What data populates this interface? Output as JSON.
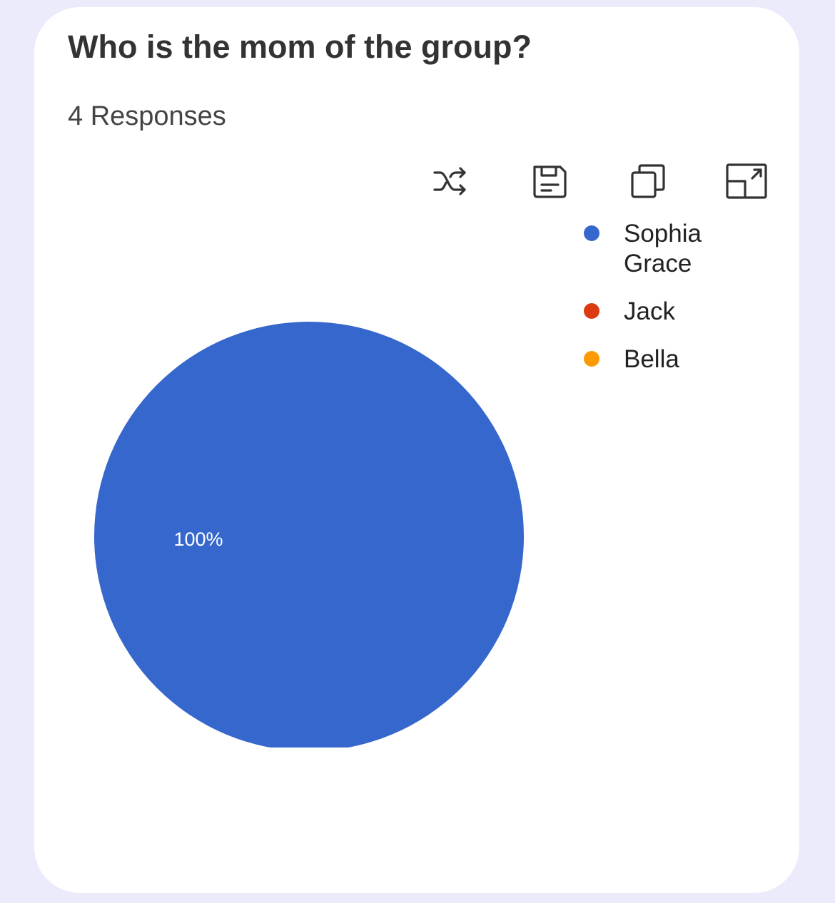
{
  "card": {
    "title": "Who is the mom of the group?",
    "responses": "4 Responses"
  },
  "toolbar": {
    "icons": [
      "shuffle-icon",
      "save-icon",
      "copy-icon",
      "expand-icon"
    ]
  },
  "colors": {
    "background": "#ecebfb",
    "card": "#ffffff",
    "sophia_grace": "#3667cc",
    "jack": "#dc3b12",
    "bella": "#fb9a05"
  },
  "chart_data": {
    "type": "pie",
    "title": "Who is the mom of the group?",
    "subtitle": "4 Responses",
    "legend_position": "top-right",
    "slices": [
      {
        "label": "Sophia Grace",
        "value": 100,
        "color": "#3667cc",
        "data_label": "100%"
      },
      {
        "label": "Jack",
        "value": 0,
        "color": "#dc3b12",
        "data_label": ""
      },
      {
        "label": "Bella",
        "value": 0,
        "color": "#fb9a05",
        "data_label": ""
      }
    ]
  }
}
